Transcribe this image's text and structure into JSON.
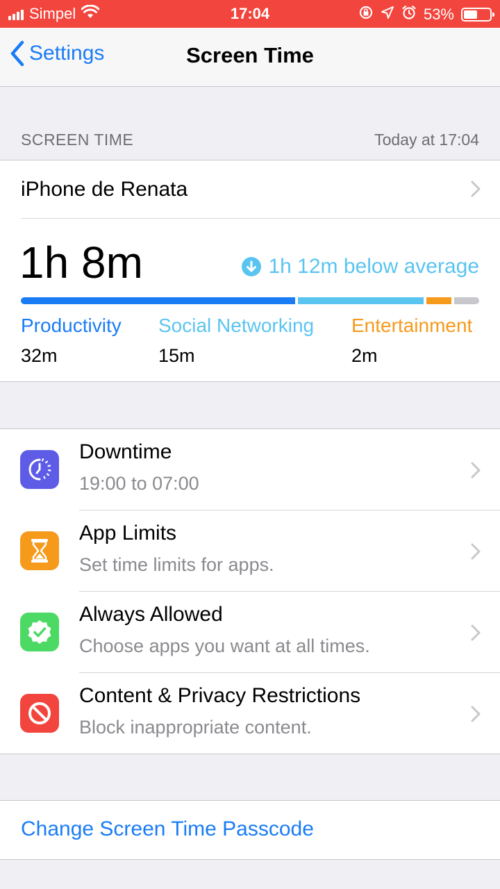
{
  "status": {
    "carrier": "Simpel",
    "time": "17:04",
    "battery_pct": "53%",
    "battery_level": 0.53,
    "icons": [
      "signal-icon",
      "wifi-icon",
      "rotation-lock-icon",
      "location-icon",
      "alarm-icon",
      "battery-icon"
    ]
  },
  "nav": {
    "back_label": "Settings",
    "title": "Screen Time"
  },
  "section": {
    "header": "SCREEN TIME",
    "timestamp": "Today at 17:04"
  },
  "summary": {
    "device": "iPhone de Renata",
    "total": "1h 8m",
    "average": "1h 12m below average",
    "categories": [
      {
        "name": "Productivity",
        "time": "32m",
        "color": "#1a7cf5",
        "share": 0.61
      },
      {
        "name": "Social Networking",
        "time": "15m",
        "color": "#5ac4f0",
        "share": 0.28
      },
      {
        "name": "Entertainment",
        "time": "2m",
        "color": "#f59a1b",
        "share": 0.055
      },
      {
        "name": "",
        "time": "",
        "color": "#c7c7cc",
        "share": 0.055
      }
    ]
  },
  "items": [
    {
      "title": "Downtime",
      "subtitle": "19:00 to 07:00",
      "icon": "downtime-icon",
      "color": "#5e5ce6"
    },
    {
      "title": "App Limits",
      "subtitle": "Set time limits for apps.",
      "icon": "hourglass-icon",
      "color": "#f59a1b"
    },
    {
      "title": "Always Allowed",
      "subtitle": "Choose apps you want at all times.",
      "icon": "checkmark-badge-icon",
      "color": "#4cd964"
    },
    {
      "title": "Content & Privacy Restrictions",
      "subtitle": "Block inappropriate content.",
      "icon": "block-icon",
      "color": "#f2453d"
    }
  ],
  "passcode": {
    "label": "Change Screen Time Passcode"
  }
}
